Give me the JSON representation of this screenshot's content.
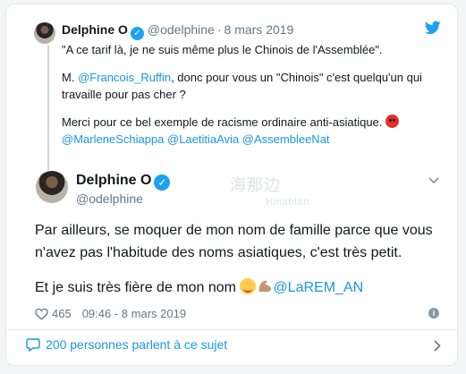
{
  "quoted_tweet": {
    "author_name": "Delphine O",
    "handle": "@odelphine",
    "date": "8 mars 2019",
    "line1": "\"A ce tarif là, je ne suis même plus le Chinois de l'Assemblée\".",
    "line2_prefix": "M. ",
    "line2_mention": "@Francois_Ruffin",
    "line2_rest": ", donc pour vous un \"Chinois\" c'est quelqu'un qui travaille pour pas cher ?",
    "line3": "Merci pour ce bel exemple de racisme ordinaire anti-asiatique. ",
    "mentions": [
      "@MarleneSchiappa",
      "@LaetitiaAvia",
      "@AssembleeNat"
    ]
  },
  "main_tweet": {
    "author_name": "Delphine O",
    "handle": "@odelphine",
    "paragraph1": "Par ailleurs, se moquer de mon nom de famille parce que vous n'avez pas l'habitude des noms asiatiques, c'est très petit.",
    "paragraph2": "Et je suis très fière de mon nom ",
    "paragraph2_mention": "@LaREM_AN"
  },
  "meta": {
    "likes": "465",
    "time": "09:46 - 8 mars 2019"
  },
  "conversation": {
    "label": "200 personnes parlent à ce sujet"
  },
  "watermark": {
    "text": "海那边",
    "subtext": "Hinabian"
  },
  "colors": {
    "accent": "#1b95e0",
    "twitter_blue": "#1da1f2",
    "muted": "#657786",
    "text": "#14171a"
  },
  "icons": [
    "verified-badge-icon",
    "twitter-bird-icon",
    "chevron-down-icon",
    "heart-icon",
    "info-icon",
    "reply-bubble-icon",
    "chevron-right-icon",
    "angry-face-emoji",
    "smiling-face-emoji",
    "flexed-biceps-emoji"
  ]
}
